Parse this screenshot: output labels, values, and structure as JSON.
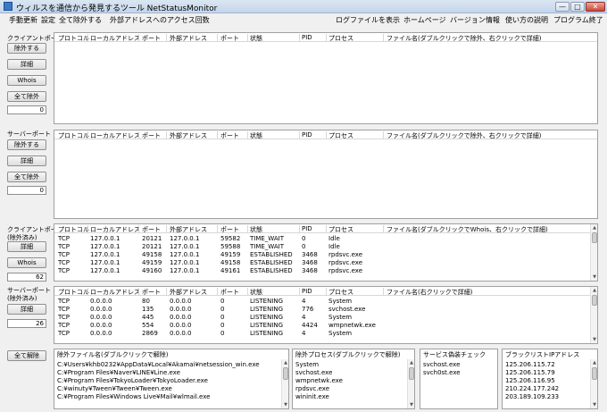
{
  "window": {
    "title": "ウィルスを通信から発見するツール NetStatusMonitor",
    "min": "—",
    "max": "□",
    "close": "✕"
  },
  "menu": {
    "left": [
      "手動更新",
      "設定",
      "全て除外する",
      "外部アドレスへのアクセス回数"
    ],
    "right": [
      "ログファイルを表示",
      "ホームページ",
      "バージョン情報",
      "使い方の説明",
      "プログラム終了"
    ]
  },
  "headers": {
    "protocol": "プロトコル",
    "local": "ローカルアドレス",
    "port": "ポート",
    "remote": "外部アドレス",
    "port2": "ポート",
    "state": "状態",
    "pid": "PID",
    "process": "プロセス",
    "file1": "ファイル名(ダブルクリックで除外、右クリックで詳細)",
    "file3": "ファイル名(ダブルクリックでWhois、右クリックで詳細)",
    "file4": "ファイル名(右クリックで詳細)"
  },
  "sections": {
    "client": {
      "label": "クライアントポート",
      "exclude": "除外する",
      "detail": "詳細",
      "whois": "Whois",
      "all_exclude": "全て除外",
      "count": "0"
    },
    "server": {
      "label": "サーバーポート",
      "exclude": "除外する",
      "detail": "詳細",
      "all_exclude": "全て除外",
      "count": "0"
    },
    "client_ex": {
      "label1": "クライアントポート",
      "label2": "(除外済み)",
      "detail": "詳細",
      "whois": "Whois",
      "count": "62"
    },
    "server_ex": {
      "label1": "サーバーポート",
      "label2": "(除外済み)",
      "detail": "詳細",
      "count": "26"
    },
    "all_release": "全て解除"
  },
  "client_ex_rows": [
    [
      "TCP",
      "127.0.0.1",
      "20121",
      "127.0.0.1",
      "59582",
      "TIME_WAIT",
      "0",
      "Idle"
    ],
    [
      "TCP",
      "127.0.0.1",
      "20121",
      "127.0.0.1",
      "59588",
      "TIME_WAIT",
      "0",
      "Idle"
    ],
    [
      "TCP",
      "127.0.0.1",
      "49158",
      "127.0.0.1",
      "49159",
      "ESTABLISHED",
      "3468",
      "rpdsvc.exe"
    ],
    [
      "TCP",
      "127.0.0.1",
      "49159",
      "127.0.0.1",
      "49158",
      "ESTABLISHED",
      "3468",
      "rpdsvc.exe"
    ],
    [
      "TCP",
      "127.0.0.1",
      "49160",
      "127.0.0.1",
      "49161",
      "ESTABLISHED",
      "3468",
      "rpdsvc.exe"
    ]
  ],
  "server_ex_rows": [
    [
      "TCP",
      "0.0.0.0",
      "80",
      "0.0.0.0",
      "0",
      "LISTENING",
      "4",
      "System"
    ],
    [
      "TCP",
      "0.0.0.0",
      "135",
      "0.0.0.0",
      "0",
      "LISTENING",
      "776",
      "svchost.exe"
    ],
    [
      "TCP",
      "0.0.0.0",
      "445",
      "0.0.0.0",
      "0",
      "LISTENING",
      "4",
      "System"
    ],
    [
      "TCP",
      "0.0.0.0",
      "554",
      "0.0.0.0",
      "0",
      "LISTENING",
      "4424",
      "wmpnetwk.exe"
    ],
    [
      "TCP",
      "0.0.0.0",
      "2869",
      "0.0.0.0",
      "0",
      "LISTENING",
      "4",
      "System"
    ]
  ],
  "excluded_files": {
    "title": "除外ファイル名(ダブルクリックで解除)",
    "items": [
      "C:¥Users¥khb0232¥AppData¥Local¥Akamai¥netsession_win.exe",
      "C:¥Program Files¥Naver¥LINE¥Line.exe",
      "C:¥Program Files¥TokyoLoader¥TokyoLoader.exe",
      "C:¥winuty¥Tween¥Tween¥Tween.exe",
      "C:¥Program Files¥Windows Live¥Mail¥wlmail.exe"
    ]
  },
  "excluded_processes": {
    "title": "除外プロセス(ダブルクリックで解除)",
    "items": [
      "System",
      "svchost.exe",
      "wmpnetwk.exe",
      "rpdsvc.exe",
      "wininit.exe"
    ]
  },
  "service_check": {
    "title": "サービス偽装チェック",
    "items": [
      "svchost.exe",
      "svch0st.exe"
    ]
  },
  "blacklist": {
    "title": "ブラックリストIPアドレス",
    "items": [
      "125.206.115.72",
      "125.206.115.79",
      "125.206.116.95",
      "210.224.177.242",
      "203.189.109.233"
    ]
  }
}
